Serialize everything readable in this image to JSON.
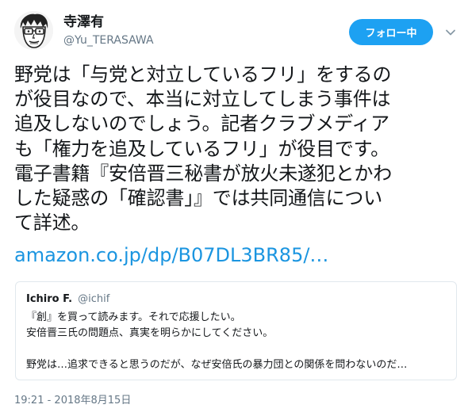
{
  "author": {
    "name": "寺澤有",
    "handle": "@Yu_TERASAWA",
    "avatar_icon": "manga-face-avatar"
  },
  "follow_button": {
    "label": "フォロー中"
  },
  "menu_icon": "chevron-down-icon",
  "tweet": {
    "lines": [
      "野党は「与党と対立しているフリ」をするの",
      "が役目なので、本当に対立してしまう事件は",
      "追及しないのでしょう。記者クラブメディア",
      "も「権力を追及しているフリ」が役目です。",
      "電子書籍『安倍晋三秘書が放火未遂犯とかわ",
      "した疑惑の「確認書」』では共同通信につい",
      "て詳述。"
    ],
    "link": "amazon.co.jp/dp/B07DL3BR85/…"
  },
  "quoted_tweet": {
    "name": "Ichiro F.",
    "handle": "@ichif",
    "lines": [
      "『創』を買って読みます。それで応援したい。",
      "安倍晋三氏の問題点、真実を明らかにしてください。",
      "",
      "野党は…追求できると思うのだが、なぜ安倍氏の暴力団との関係を問わないのだ…"
    ]
  },
  "timestamp": "19:21 - 2018年8月15日",
  "colors": {
    "accent": "#1da1f2",
    "link": "#1b95e0",
    "secondary_text": "#657786",
    "border": "#e1e8ed"
  }
}
